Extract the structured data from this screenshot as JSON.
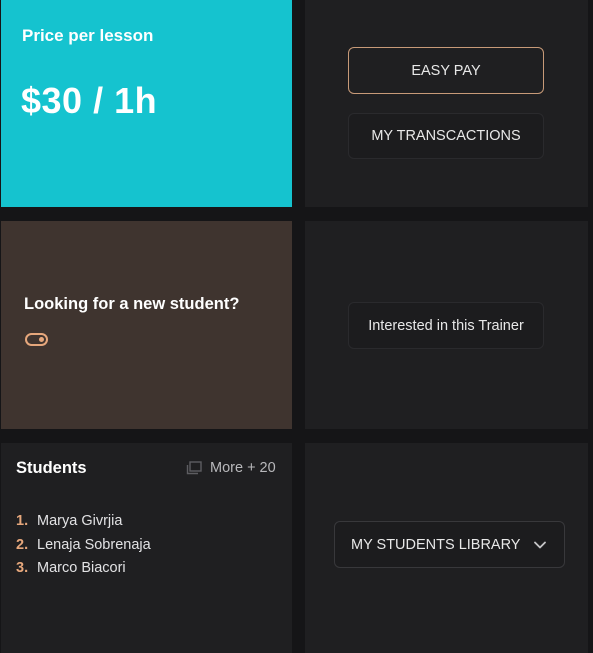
{
  "price_card": {
    "label": "Price per lesson",
    "value": "$30 / 1h"
  },
  "payment_actions": {
    "easy_pay_label": "EASY PAY",
    "transactions_label": "MY TRANSCACTIONS"
  },
  "looking_card": {
    "title": "Looking for a new student?",
    "toggle_on": true
  },
  "trainer_actions": {
    "interested_label": "Interested in this Trainer"
  },
  "students_card": {
    "title": "Students",
    "more_label": "More + 20",
    "students": [
      {
        "num": "1.",
        "name": "Marya Givrjia"
      },
      {
        "num": "2.",
        "name": "Lenaja Sobrenaja"
      },
      {
        "num": "3.",
        "name": "Marco Biacori"
      }
    ]
  },
  "library": {
    "dropdown_label": "MY STUDENTS LIBRARY"
  },
  "colors": {
    "accent_cyan": "#15c3cf",
    "accent_orange": "#e6a77c",
    "card_brown": "#3f342f",
    "card_dark": "#1f1f21",
    "background": "#151517"
  }
}
